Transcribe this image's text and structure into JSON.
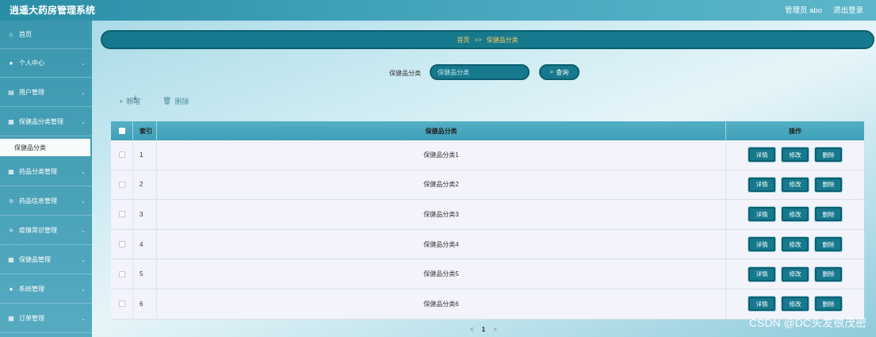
{
  "app": {
    "title": "逍遥大药房管理系统"
  },
  "header": {
    "user": "管理员 abo",
    "logout": "退出登录"
  },
  "sidebar": {
    "items": [
      {
        "label": "首页",
        "icon": "home-icon",
        "glyph": "⌂",
        "has_chevron": false
      },
      {
        "label": "个人中心",
        "icon": "user-icon",
        "glyph": "●",
        "has_chevron": true
      },
      {
        "label": "用户管理",
        "icon": "list-icon",
        "glyph": "▤",
        "has_chevron": true
      },
      {
        "label": "保健品分类管理",
        "icon": "grid-icon",
        "glyph": "▦",
        "has_chevron": true
      },
      {
        "label": "药品分类管理",
        "icon": "grid-icon",
        "glyph": "▦",
        "has_chevron": true
      },
      {
        "label": "药品信息管理",
        "icon": "sliders-icon",
        "glyph": "≑",
        "has_chevron": true
      },
      {
        "label": "疫情常识管理",
        "icon": "menu-icon",
        "glyph": "≡",
        "has_chevron": true
      },
      {
        "label": "保健品管理",
        "icon": "grid-icon",
        "glyph": "▦",
        "has_chevron": true
      },
      {
        "label": "系统管理",
        "icon": "location-icon",
        "glyph": "●",
        "has_chevron": true
      },
      {
        "label": "订单管理",
        "icon": "grid-icon",
        "glyph": "▦",
        "has_chevron": true
      }
    ],
    "sub_item": "保健品分类",
    "chevron": "⌄"
  },
  "breadcrumb": {
    "home": "首页",
    "sep": ">>",
    "current": "保健品分类"
  },
  "search": {
    "label": "保健品分类",
    "placeholder": "保健品分类",
    "button": "查询",
    "button_icon": "search-icon"
  },
  "toolbar": {
    "add": "新增",
    "delete": "删除"
  },
  "table": {
    "headers": {
      "index": "索引",
      "name": "保健品分类",
      "ops": "操作"
    },
    "rows": [
      {
        "index": "1",
        "name": "保健品分类1"
      },
      {
        "index": "2",
        "name": "保健品分类2"
      },
      {
        "index": "3",
        "name": "保健品分类3"
      },
      {
        "index": "4",
        "name": "保健品分类4"
      },
      {
        "index": "5",
        "name": "保健品分类5"
      },
      {
        "index": "6",
        "name": "保健品分类6"
      }
    ],
    "row_actions": {
      "detail": "详情",
      "edit": "修改",
      "delete": "删除"
    }
  },
  "pager": {
    "prev": "<",
    "page": "1",
    "next": ">"
  },
  "watermark": "CSDN @DC头发很茂密",
  "colors": {
    "accent": "#16798d",
    "breadcrumb_text": "#f7c85d"
  }
}
